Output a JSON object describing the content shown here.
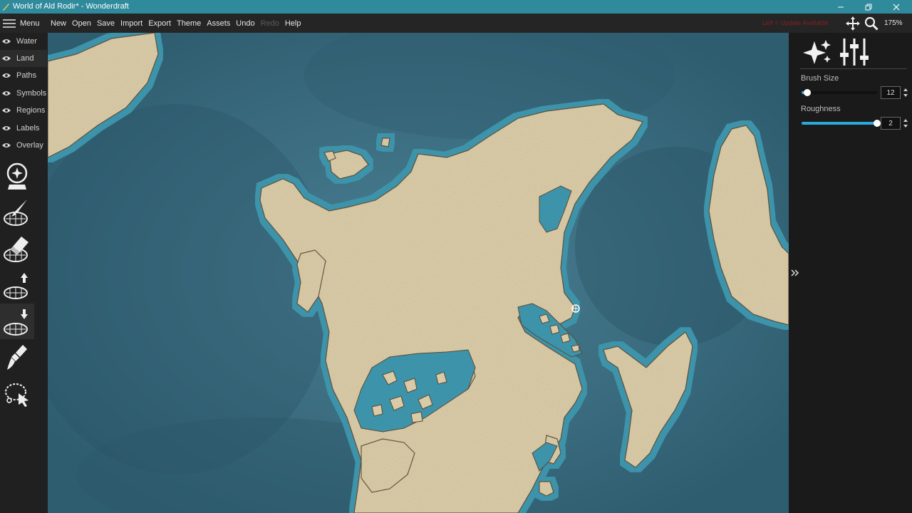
{
  "window": {
    "title": "World of Ald Rodir* - Wonderdraft"
  },
  "menubar": {
    "menu_label": "Menu",
    "items": [
      "New",
      "Open",
      "Save",
      "Import",
      "Export",
      "Theme",
      "Assets",
      "Undo",
      "Redo",
      "Help"
    ],
    "status_text": "Left = Update Available",
    "zoom": "175%"
  },
  "layers": [
    "Water",
    "Land",
    "Paths",
    "Symbols",
    "Regions",
    "Labels",
    "Overlay"
  ],
  "active_layer": "Land",
  "tools": [
    {
      "name": "magic-brush-icon"
    },
    {
      "name": "land-brush-icon"
    },
    {
      "name": "land-eraser-icon"
    },
    {
      "name": "raise-land-icon"
    },
    {
      "name": "lower-land-icon",
      "active": true
    },
    {
      "name": "paint-brush-icon"
    },
    {
      "name": "selection-tool-icon"
    }
  ],
  "brush": {
    "size_label": "Brush Size",
    "size_value": "12",
    "size_fraction": 0.08,
    "roughness_label": "Roughness",
    "roughness_value": "2",
    "roughness_fraction": 1.0
  },
  "colors": {
    "titlebar": "#2f8a9c",
    "water": "#3f7186",
    "land": "#d9cba7",
    "accent": "#29a9d9"
  }
}
